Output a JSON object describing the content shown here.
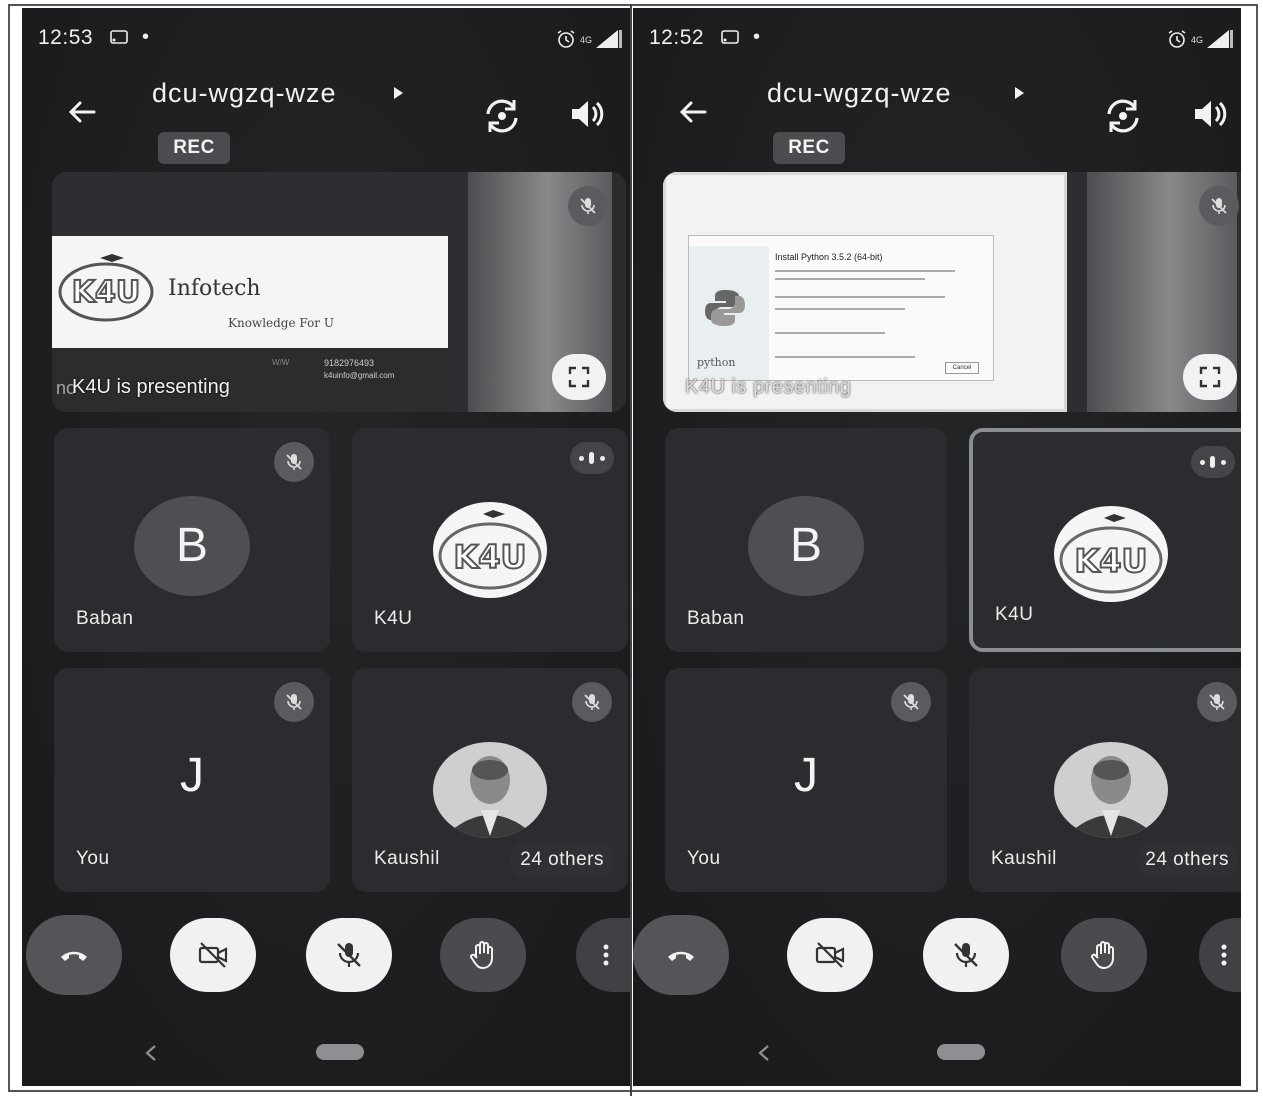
{
  "left": {
    "status": {
      "time": "12:53",
      "dot": "•",
      "network": "4G"
    },
    "meeting_code": "dcu-wgzq-wze",
    "rec_label": "REC",
    "presentation": {
      "presenting_text": "K4U is presenting",
      "overlap_text": "no",
      "slide_company": "Infotech",
      "slide_tagline": "Knowledge For U",
      "slide_logo_text": "K4U",
      "slide_phone": "9182976493",
      "slide_email": "k4uinfo@gmail.com",
      "slide_web_label": "W/W"
    },
    "tiles": [
      {
        "name": "Baban",
        "avatar_letter": "B",
        "mic": "muted"
      },
      {
        "name": "K4U",
        "avatar_text": "K4U",
        "mic": "speaking"
      },
      {
        "name": "You",
        "avatar_letter": "J",
        "mic": "muted"
      },
      {
        "name": "Kaushil",
        "avatar": "photo",
        "mic": "muted",
        "others": "24 others"
      }
    ]
  },
  "right": {
    "status": {
      "time": "12:52",
      "dot": "•",
      "network": "4G"
    },
    "meeting_code": "dcu-wgzq-wze",
    "rec_label": "REC",
    "presentation": {
      "presenting_text": "K4U is presenting",
      "install_title": "Install Python 3.5.2 (64-bit)",
      "python_label": "python",
      "cancel_label": "Cancel"
    },
    "tiles": [
      {
        "name": "Baban",
        "avatar_letter": "B",
        "mic": "muted"
      },
      {
        "name": "K4U",
        "avatar_text": "K4U",
        "mic": "speaking",
        "active": true
      },
      {
        "name": "You",
        "avatar_letter": "J",
        "mic": "muted"
      },
      {
        "name": "Kaushil",
        "avatar": "photo",
        "mic": "muted",
        "others": "24 others"
      }
    ]
  },
  "colors": {
    "background": "#1d1e20",
    "tile": "#2b2c2f",
    "light_button": "#f1f1f1",
    "active_border": "#8a8d92"
  },
  "icons": [
    "back-arrow-icon",
    "flip-camera-icon",
    "speaker-icon",
    "mic-off-icon",
    "fullscreen-icon",
    "hang-up-icon",
    "camera-off-icon",
    "raise-hand-icon",
    "more-vert-icon"
  ]
}
